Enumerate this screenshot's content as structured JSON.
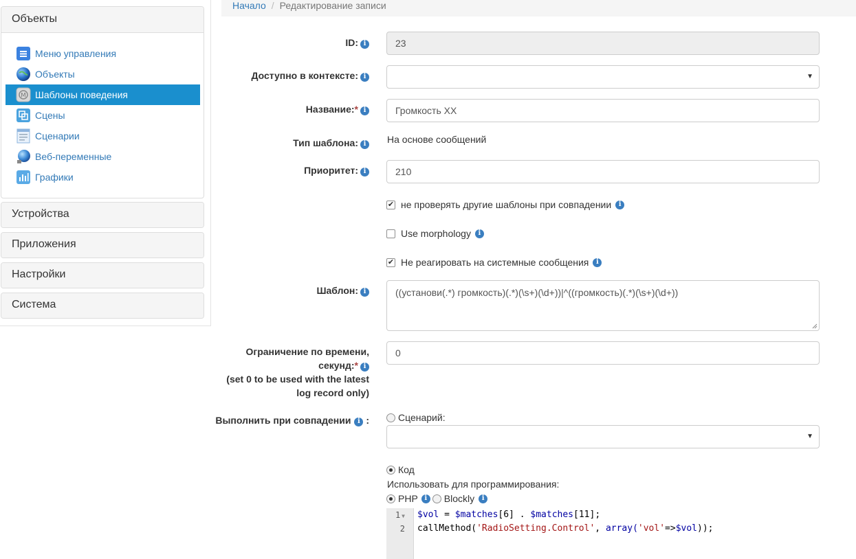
{
  "sidebar": {
    "objects_panel": {
      "title": "Объекты",
      "items": [
        {
          "label": "Меню управления",
          "icon": "menu-icon"
        },
        {
          "label": "Объекты",
          "icon": "globe-icon"
        },
        {
          "label": "Шаблоны поведения",
          "icon": "template-icon",
          "active": true
        },
        {
          "label": "Сцены",
          "icon": "scenes-icon"
        },
        {
          "label": "Сценарии",
          "icon": "scripts-icon"
        },
        {
          "label": "Веб-переменные",
          "icon": "web-globe-icon"
        },
        {
          "label": "Графики",
          "icon": "chart-icon"
        }
      ]
    },
    "collapsed_panels": [
      "Устройства",
      "Приложения",
      "Настройки",
      "Система"
    ]
  },
  "breadcrumb": {
    "home": "Начало",
    "separator": "/",
    "current": "Редактирование записи"
  },
  "form": {
    "id": {
      "label": "ID:",
      "value": "23"
    },
    "context": {
      "label": "Доступно в контексте:",
      "value": ""
    },
    "name": {
      "label": "Название:",
      "required_mark": "*",
      "value": "Громкость ХХ"
    },
    "template_type": {
      "label": "Тип шаблона:",
      "value": "На основе сообщений"
    },
    "priority": {
      "label": "Приоритет:",
      "value": "210"
    },
    "checkbox_skip_others": {
      "label": "не проверять другие шаблоны при совпадении",
      "checked": true
    },
    "checkbox_morphology": {
      "label": "Use morphology",
      "checked": false
    },
    "checkbox_ignore_system": {
      "label": "Не реагировать на системные сообщения",
      "checked": true
    },
    "pattern": {
      "label": "Шаблон:",
      "value": "((установи(.*) громкость)(.*)(\\s+)(\\d+))|^((громкость)(.*)(\\s+)(\\d+))"
    },
    "time_limit": {
      "label_line1": "Ограничение по времени,",
      "label_line2": "секунд:",
      "required_mark": "*",
      "label_line3": "(set 0 to be used with the latest",
      "label_line4": "log record only)",
      "value": "0"
    },
    "on_match": {
      "label": "Выполнить при совпадении",
      "label_colon": ":",
      "script_radio_label": "Сценарий:",
      "script_radio_checked": false,
      "script_select_value": "",
      "code_radio_label": "Код",
      "code_radio_checked": true,
      "use_for_programming": "Использовать для программирования:",
      "php_label": "PHP",
      "php_checked": true,
      "blockly_label": "Blockly",
      "blockly_checked": false
    },
    "code_editor": {
      "line_numbers": [
        "1",
        "2"
      ],
      "line1": {
        "var": "$vol",
        "op1": " = ",
        "m1": "$matches",
        "idx1": "[6]",
        "op2": " . ",
        "m2": "$matches",
        "idx2": "[11]",
        "end": ";"
      },
      "line2": {
        "fn": "callMethod(",
        "str1": "'RadioSetting.Control'",
        "mid": ", ",
        "arr": "array(",
        "str2": "'vol'",
        "arrow": "=>",
        "var": "$vol",
        "end": "));"
      }
    }
  },
  "colors": {
    "accent": "#337ab7",
    "active_bg": "#1a8fce",
    "info_badge": "#3a7ec0",
    "required": "#a94442"
  }
}
